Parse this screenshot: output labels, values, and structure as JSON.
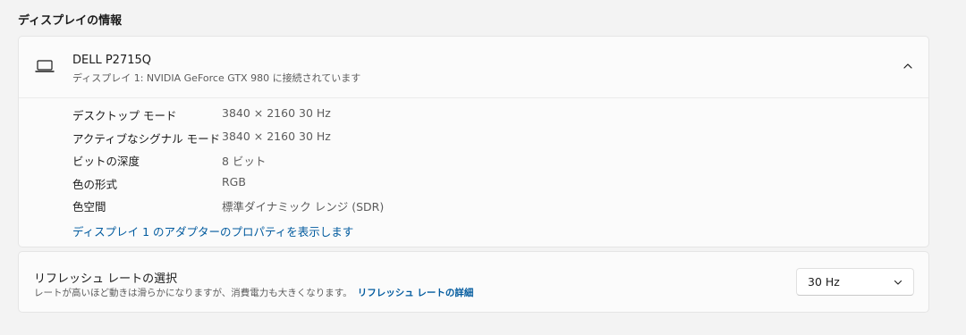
{
  "section": {
    "title": "ディスプレイの情報"
  },
  "display": {
    "name": "DELL P2715Q",
    "subtitle": "ディスプレイ 1: NVIDIA GeForce GTX 980 に接続されています",
    "icon": "monitor-icon",
    "expanded": true,
    "info": [
      {
        "label": "デスクトップ モード",
        "value": "3840 × 2160 30 Hz"
      },
      {
        "label": "アクティブなシグナル モード",
        "value": "3840 × 2160 30 Hz"
      },
      {
        "label": "ビットの深度",
        "value": "8 ビット"
      },
      {
        "label": "色の形式",
        "value": "RGB"
      },
      {
        "label": "色空間",
        "value": "標準ダイナミック レンジ (SDR)"
      }
    ],
    "adapter_link": "ディスプレイ 1 のアダプターのプロパティを表示します"
  },
  "refresh": {
    "title": "リフレッシュ レートの選択",
    "description": "レートが高いほど動きは滑らかになりますが、消費電力も大きくなります。",
    "details_link": "リフレッシュ レートの詳細",
    "selected": "30 Hz"
  },
  "colors": {
    "background": "#f3f3f3",
    "card": "#fbfbfb",
    "link": "#005a9e"
  }
}
